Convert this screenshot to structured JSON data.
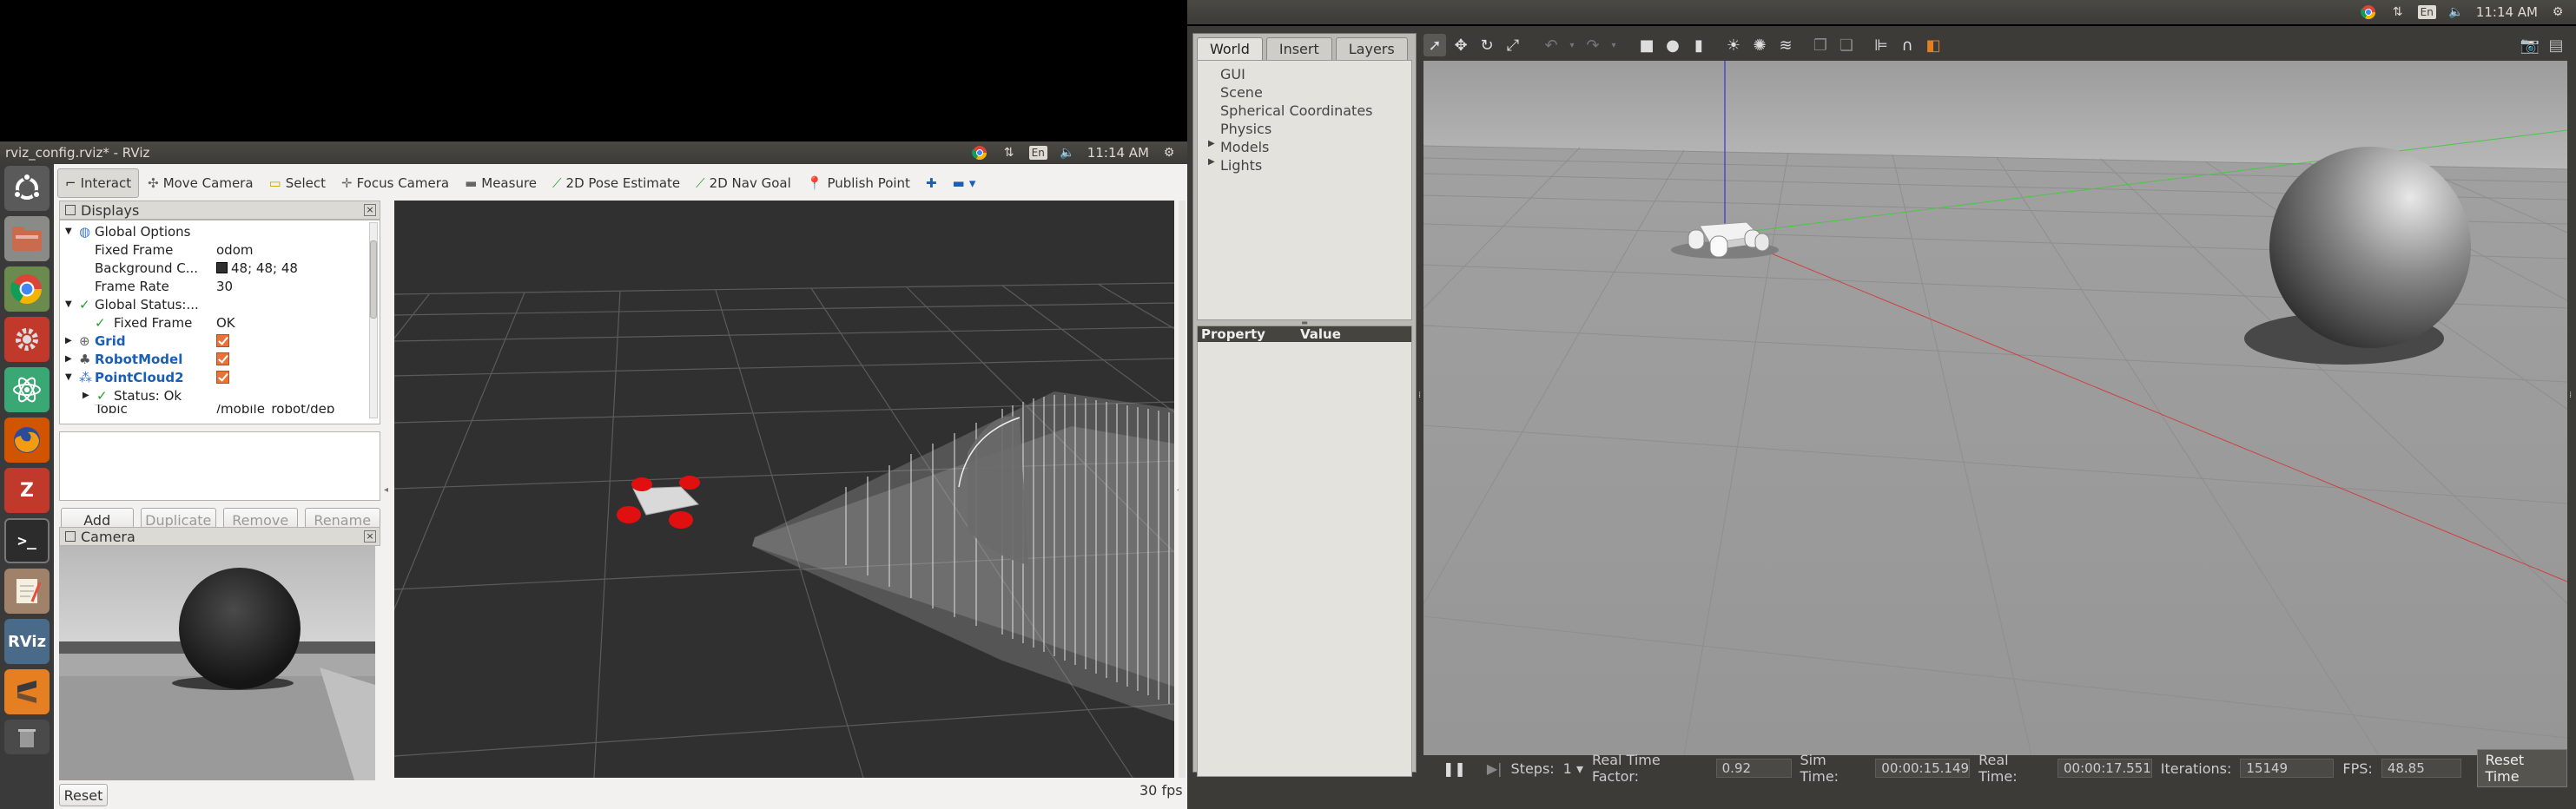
{
  "top_left_bar": {
    "clock": "11:14 AM",
    "lang": "En"
  },
  "top_right_bar": {
    "clock": "11:14 AM",
    "lang": "En"
  },
  "launcher": {
    "items": [
      "ubuntu-dash",
      "files",
      "chrome",
      "settings",
      "atom",
      "firefox",
      "zotero",
      "terminal",
      "text-editor",
      "rviz",
      "sublime",
      "trash"
    ],
    "rviz_label": "RViz",
    "zotero_label": "Z"
  },
  "rviz": {
    "title": "rviz_config.rviz* - RViz",
    "toolbar": [
      "Interact",
      "Move Camera",
      "Select",
      "Focus Camera",
      "Measure",
      "2D Pose Estimate",
      "2D Nav Goal",
      "Publish Point"
    ],
    "displays_title": "Displays",
    "tree": {
      "global_options": "Global Options",
      "fixed_frame_k": "Fixed Frame",
      "fixed_frame_v": "odom",
      "bg_k": "Background C...",
      "bg_v": "48; 48; 48",
      "frame_rate_k": "Frame Rate",
      "frame_rate_v": "30",
      "global_status": "Global Status:...",
      "fixed_frame2_k": "Fixed Frame",
      "fixed_frame2_v": "OK",
      "grid": "Grid",
      "robot_model": "RobotModel",
      "pointcloud": "PointCloud2",
      "status_ok": "Status: Ok",
      "topic_k": "Topic",
      "topic_v": "/mobile_robot/dep"
    },
    "buttons": {
      "add": "Add",
      "duplicate": "Duplicate",
      "remove": "Remove",
      "rename": "Rename"
    },
    "camera_title": "Camera",
    "reset": "Reset",
    "fps": "30 fps",
    "bg_color": "#303030"
  },
  "gazebo": {
    "tabs": [
      "World",
      "Insert",
      "Layers"
    ],
    "world_items": [
      "GUI",
      "Scene",
      "Spherical Coordinates",
      "Physics",
      "Models",
      "Lights"
    ],
    "prop_header": {
      "property": "Property",
      "value": "Value"
    },
    "bottom": {
      "steps_label": "Steps:",
      "steps_value": "1",
      "rtf_label": "Real Time Factor:",
      "rtf_value": "0.92",
      "sim_label": "Sim Time:",
      "sim_value": "00:00:15.149",
      "real_label": "Real Time:",
      "real_value": "00:00:17.551",
      "iter_label": "Iterations:",
      "iter_value": "15149",
      "fps_label": "FPS:",
      "fps_value": "48.85",
      "reset_time": "Reset Time"
    }
  }
}
